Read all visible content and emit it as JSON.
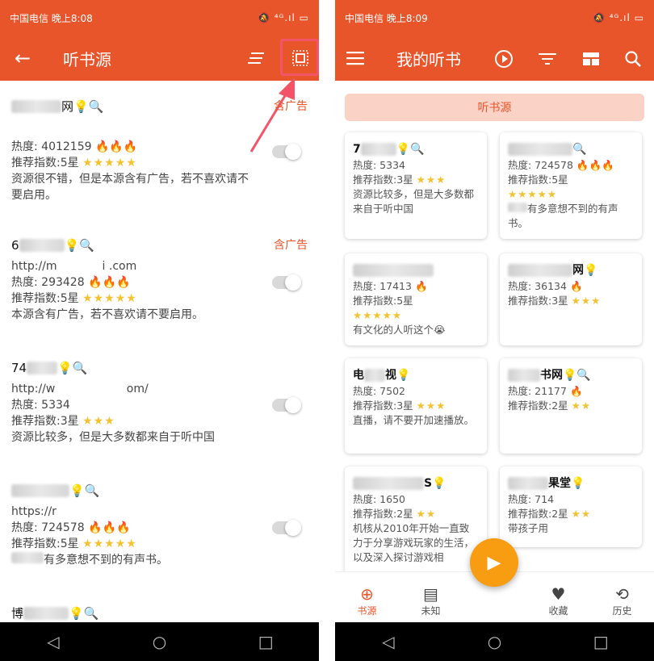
{
  "left": {
    "status": {
      "carrier": "中国电信 晚上8:08",
      "icons": "🔕 ⁴ᴳ.ıl ▭"
    },
    "title": "听书源",
    "items": [
      {
        "name_suffix": "网💡🔍",
        "ad": "含广告",
        "url": "",
        "heat": "热度: 4012159",
        "fires": "🔥🔥🔥",
        "rating": "推荐指数:5星",
        "stars": "★★★★★",
        "desc": "资源很不错，但是本源含有广告，若不喜欢请不要启用。"
      },
      {
        "name_prefix": "6",
        "name_suffix": "💡🔍",
        "ad": "含广告",
        "url": "http://m    i .com",
        "heat": "热度: 293428",
        "fires": "🔥🔥🔥",
        "rating": "推荐指数:5星",
        "stars": "★★★★★",
        "desc": "本源含有广告，若不喜欢请不要启用。"
      },
      {
        "name_prefix": "74",
        "name_suffix": "💡🔍",
        "url": "http://w       om/",
        "heat": "热度: 5334",
        "fires": "",
        "rating": "推荐指数:3星",
        "stars": "★★★",
        "desc": "资源比较多，但是大多数都来自于听中国"
      },
      {
        "name_suffix": "💡🔍",
        "url": "https://r      ",
        "heat": "热度: 724578",
        "fires": "🔥🔥🔥",
        "rating": "推荐指数:5星",
        "stars": "★★★★★",
        "desc": "有多意想不到的有声书。"
      },
      {
        "name_prefix": "博",
        "name_suffix": "💡🔍"
      }
    ]
  },
  "right": {
    "status": {
      "carrier": "中国电信 晚上8:09",
      "icons": "🔕 ⁴ᴳ.ıl ▭"
    },
    "title": "我的听书",
    "tag": "听书源",
    "cards": [
      {
        "name": "7",
        "tail": "💡🔍",
        "heat": "热度: 5334",
        "rating": "推荐指数:3星",
        "stars": "★★★",
        "desc": "资源比较多，但是大多数都来自于听中国"
      },
      {
        "name": "",
        "tail": "🔍",
        "heat": "热度: 724578",
        "fires": "🔥🔥🔥",
        "rating": "推荐指数:5星",
        "stars": "★★★★★",
        "desc": "有多意想不到的有声书。"
      },
      {
        "name": "",
        "tail": "",
        "heat": "热度: 17413",
        "fires": "🔥",
        "rating": "推荐指数:5星",
        "stars": "★★★★★",
        "desc": "有文化的人听这个😭"
      },
      {
        "name": "",
        "tail": "网💡",
        "heat": "热度: 36134",
        "fires": "🔥",
        "rating": "推荐指数:3星",
        "stars": "★★★",
        "desc": ""
      },
      {
        "name": "电",
        "tail": "视💡",
        "heat": "热度: 7502",
        "rating": "推荐指数:3星",
        "stars": "★★★",
        "desc": "直播，请不要开加速播放。"
      },
      {
        "name": "",
        "tail": "书网💡🔍",
        "heat": "热度: 21177",
        "fires": "🔥",
        "rating": "推荐指数:2星",
        "stars": "★★",
        "desc": ""
      },
      {
        "name": "",
        "tail": "S💡",
        "heat": "热度: 1650",
        "rating": "推荐指数:2星",
        "stars": "★★",
        "desc": "机核从2010年开始一直致力于分享游戏玩家的生活，以及深入探讨游戏相"
      },
      {
        "name": "",
        "tail": "果堂💡",
        "heat": "热度: 714",
        "rating": "推荐指数:2星",
        "stars": "★★",
        "desc": "带孩子用"
      }
    ],
    "tabs": [
      "书源",
      "未知",
      "收藏",
      "历史"
    ]
  }
}
